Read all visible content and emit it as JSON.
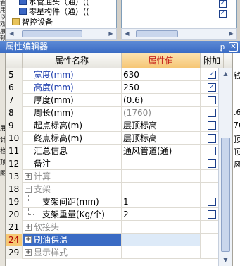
{
  "left_edge_chars": [
    "看",
    "用",
    "以",
    "观",
    "展",
    "顿"
  ],
  "tree_items": [
    {
      "label": "水管通头（通）(("
    },
    {
      "label": "零星构件（通）(("
    },
    {
      "label": "智控设备"
    }
  ],
  "right_panel": {
    "checks": [
      "✓",
      "✓"
    ]
  },
  "window": {
    "title": "属性编辑器",
    "pin": "ᵱ",
    "close": "✕"
  },
  "side_letters": [
    "展",
    "计",
    "栏",
    "顶",
    "图"
  ],
  "columns": {
    "name": "属性名称",
    "value": "属性值",
    "add": "附加"
  },
  "rows": [
    {
      "num": "5",
      "name": "宽度(mm)",
      "value": "630",
      "add": "checked",
      "style": "blue"
    },
    {
      "num": "6",
      "name": "高度(mm)",
      "value": "250",
      "add": "checked",
      "style": "blue"
    },
    {
      "num": "7",
      "name": "厚度(mm)",
      "value": "(0.6)",
      "add": "empty",
      "style": "normal"
    },
    {
      "num": "8",
      "name": "周长(mm)",
      "value": "(1760)",
      "add": "empty",
      "style": "normal"
    },
    {
      "num": "9",
      "name": "起点标高(m)",
      "value": "层顶标高",
      "add": "empty",
      "style": "normal"
    },
    {
      "num": "10",
      "name": "终点标高(m)",
      "value": "层顶标高",
      "add": "empty",
      "style": "normal"
    },
    {
      "num": "11",
      "name": "汇总信息",
      "value": "通风管道(通)",
      "add": "empty",
      "style": "normal"
    },
    {
      "num": "12",
      "name": "备注",
      "value": "",
      "add": "empty",
      "style": "normal"
    },
    {
      "num": "13",
      "name": "计算",
      "value": "",
      "add": "none",
      "style": "group"
    },
    {
      "num": "18",
      "name": "支架",
      "value": "",
      "add": "none",
      "style": "group-open"
    },
    {
      "num": "19",
      "name": "支架间距(mm)",
      "value": "1",
      "add": "empty",
      "style": "child"
    },
    {
      "num": "20",
      "name": "支架重量(Kg/个)",
      "value": "2",
      "add": "empty",
      "style": "child"
    },
    {
      "num": "21",
      "name": "软接头",
      "value": "",
      "add": "none",
      "style": "group"
    },
    {
      "num": "24",
      "name": "刷油保温",
      "value": "",
      "add": "none",
      "style": "group-selected"
    },
    {
      "num": "29",
      "name": "显示样式",
      "value": "",
      "add": "none",
      "style": "group"
    }
  ],
  "right_strip_text": [
    "钱",
    "",
    "",
    ".6",
    "76",
    "顶",
    "顶",
    "风"
  ]
}
